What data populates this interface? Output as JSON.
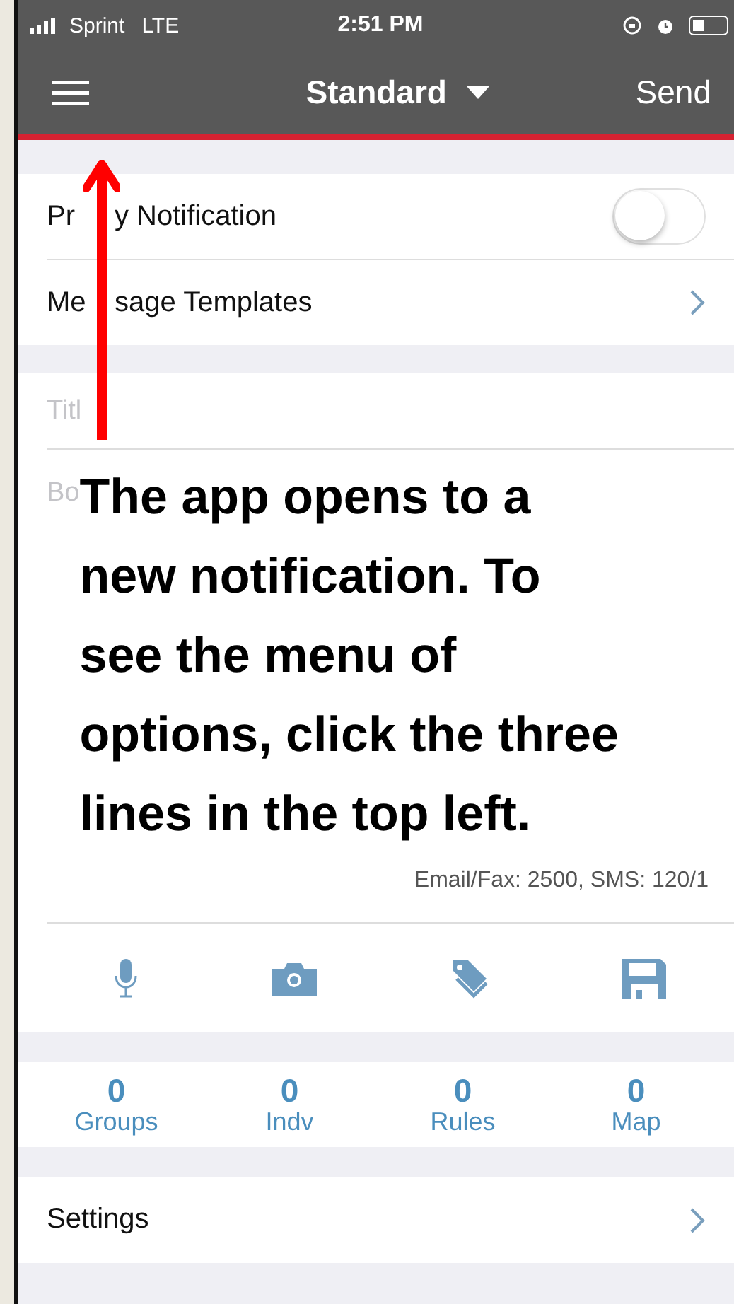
{
  "status_bar": {
    "carrier": "Sprint",
    "network": "LTE",
    "time": "2:51 PM"
  },
  "header": {
    "title": "Standard",
    "action": "Send"
  },
  "options": [
    {
      "kind": "toggle",
      "label_parts": [
        "Pr",
        "y Notification"
      ],
      "on": false
    },
    {
      "kind": "link",
      "label_parts": [
        "Me",
        "sage Templates"
      ]
    }
  ],
  "compose": {
    "title_placeholder": "Titl",
    "body_placeholder": "Bo",
    "limits": "Email/Fax: 2500, SMS: 120/1"
  },
  "recipients": [
    {
      "count": "0",
      "label": "Groups"
    },
    {
      "count": "0",
      "label": "Indv"
    },
    {
      "count": "0",
      "label": "Rules"
    },
    {
      "count": "0",
      "label": "Map"
    }
  ],
  "settings": {
    "label": "Settings"
  },
  "annotation": {
    "text": "The app opens to a\nnew notification. To\nsee the menu of\noptions, click the three\nlines in the top left."
  }
}
